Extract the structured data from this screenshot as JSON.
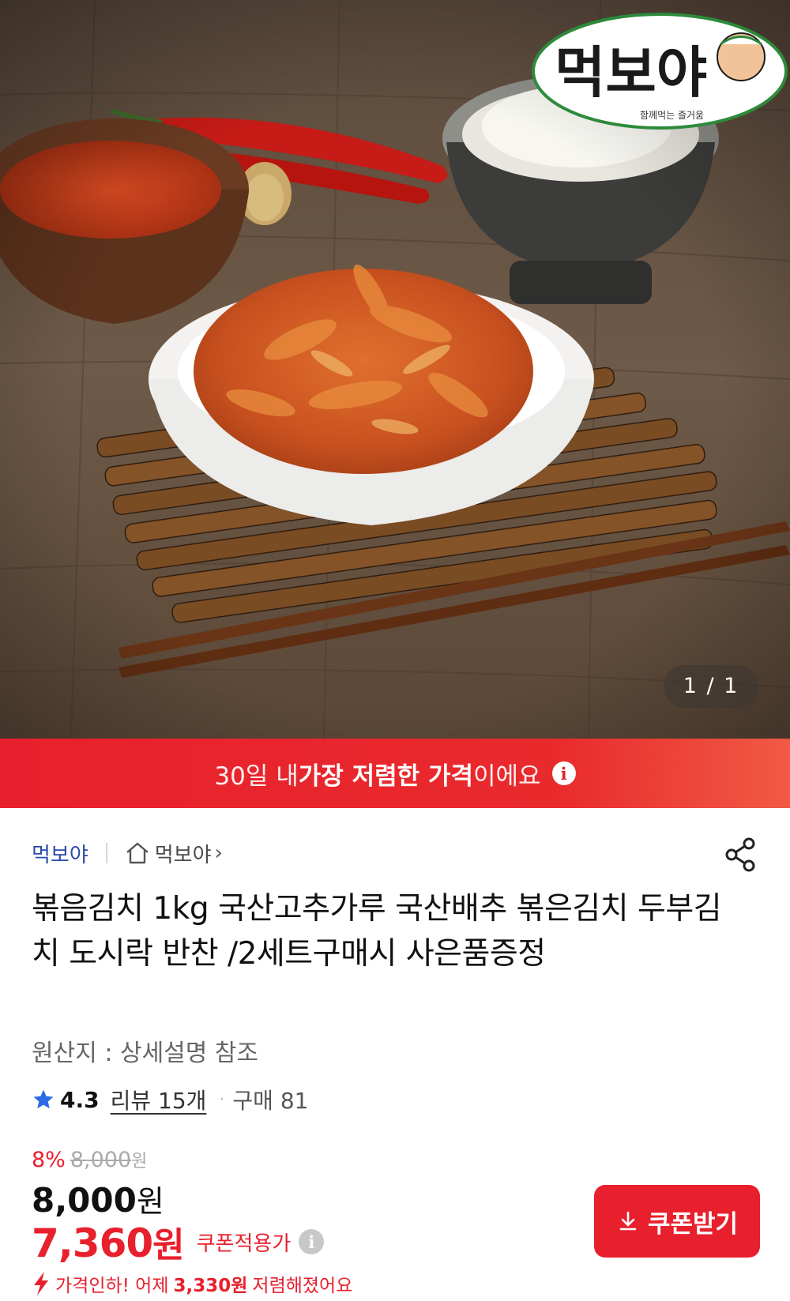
{
  "hero": {
    "brand_logo_text": "먹보야",
    "brand_logo_tagline": "함께먹는 즐거움",
    "page_indicator": "1 / 1"
  },
  "banner": {
    "prefix": "30일 내 ",
    "highlight": "가장 저렴한 가격",
    "suffix": "이에요"
  },
  "product": {
    "seller_name": "먹보야",
    "store_link": "먹보야",
    "title": "볶음김치 1kg 국산고추가루 국산배추 볶은김치 두부김치 도시락 반찬 /2세트구매시 사은품증정",
    "origin": "원산지 : 상세설명 참조",
    "rating": "4.3",
    "review_link": "리뷰 15개",
    "purchase_count": "구매 81"
  },
  "price": {
    "discount_rate": "8%",
    "original_price": "8,000",
    "original_unit": "원",
    "sale_price": "8,000",
    "sale_unit": "원",
    "coupon_price": "7,360",
    "coupon_unit": "원",
    "coupon_label": "쿠폰적용가",
    "drop_prefix": "가격인하! 어제",
    "drop_amount": "3,330원",
    "drop_suffix": "저렴해졌어요"
  },
  "actions": {
    "coupon_button": "쿠폰받기"
  },
  "colors": {
    "accent_red": "#e8202d",
    "seller_blue": "#2a4aa8",
    "star_blue": "#2b6be6"
  },
  "icons": {
    "info": "info-icon",
    "home": "home-icon",
    "share": "share-icon",
    "star": "star-icon",
    "download": "download-icon",
    "price_drop": "lightning-icon"
  }
}
